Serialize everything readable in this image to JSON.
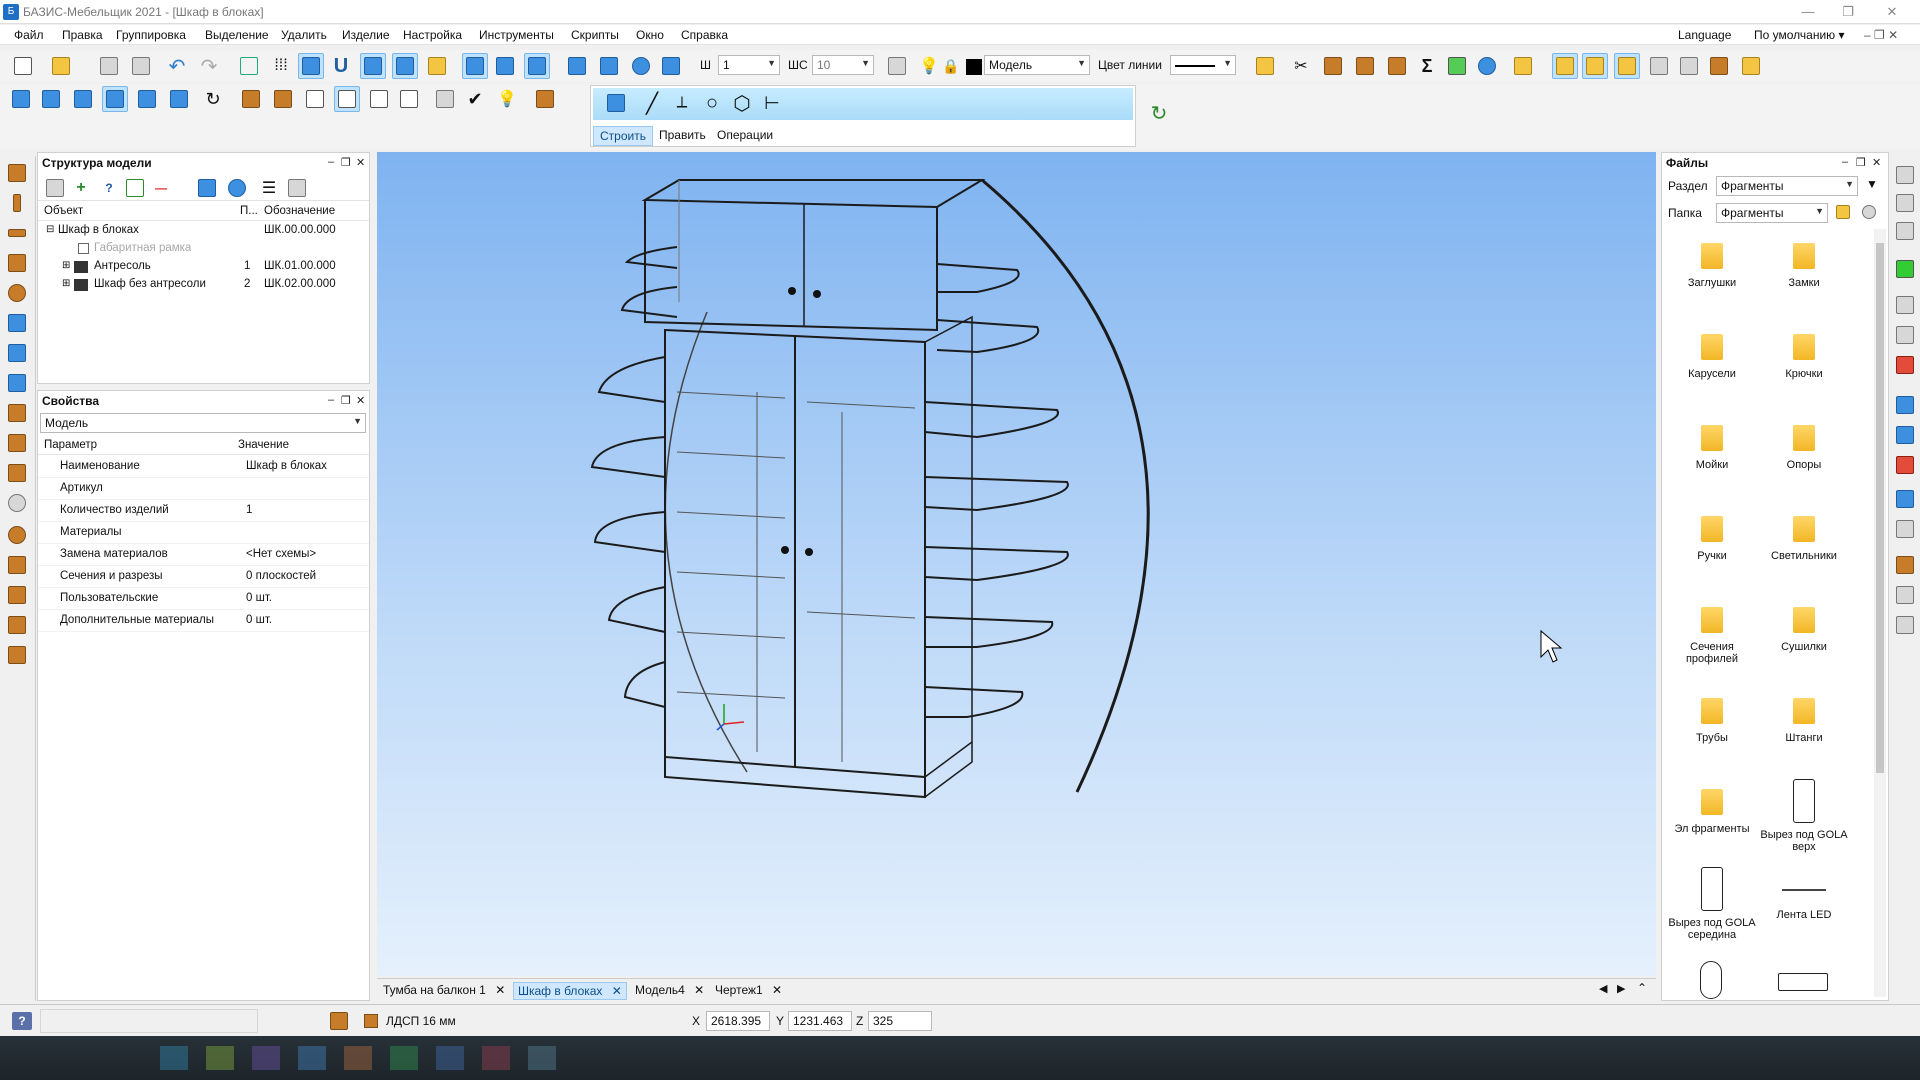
{
  "window": {
    "title": "БАЗИС-Мебельщик 2021 - [Шкаф в блоках]",
    "min": "—",
    "restore": "❐",
    "close": "✕"
  },
  "menu": {
    "items": [
      "Файл",
      "Правка",
      "Группировка",
      "Выделение",
      "Удалить",
      "Изделие",
      "Настройка",
      "Инструменты",
      "Скрипты",
      "Окно",
      "Справка"
    ],
    "language": "Language",
    "default_label": "По умолчанию ▾"
  },
  "toolbar": {
    "w_label": "Ш",
    "w_value": "1",
    "ws_label": "ШС",
    "ws_value": "10",
    "layer_value": "Модель",
    "line_color_label": "Цвет линии",
    "sub_tabs": [
      "Строить",
      "Править",
      "Операции"
    ]
  },
  "structure": {
    "title": "Структура модели",
    "col_object": "Объект",
    "col_p": "П...",
    "col_designation": "Обозначение",
    "rows": [
      {
        "name": "Шкаф в блоках",
        "qty": "",
        "code": "ШК.00.00.000"
      },
      {
        "name": "Габаритная рамка",
        "qty": "",
        "code": ""
      },
      {
        "name": "Антресоль",
        "qty": "1",
        "code": "ШК.01.00.000"
      },
      {
        "name": "Шкаф без антресоли",
        "qty": "2",
        "code": "ШК.02.00.000"
      }
    ]
  },
  "properties": {
    "title": "Свойства",
    "selector": "Модель",
    "col_param": "Параметр",
    "col_value": "Значение",
    "rows": [
      {
        "param": "Наименование",
        "value": "Шкаф в блоках"
      },
      {
        "param": "Артикул",
        "value": ""
      },
      {
        "param": "Количество изделий",
        "value": "1"
      },
      {
        "param": "Материалы",
        "value": ""
      },
      {
        "param": "Замена материалов",
        "value": "<Нет схемы>"
      },
      {
        "param": "Сечения и разрезы",
        "value": "0 плоскостей"
      },
      {
        "param": "Пользовательские",
        "value": "0 шт."
      },
      {
        "param": "Дополнительные материалы",
        "value": "0 шт."
      }
    ]
  },
  "files": {
    "title": "Файлы",
    "section_label": "Раздел",
    "section_value": "Фрагменты",
    "folder_label": "Папка",
    "folder_value": "Фрагменты",
    "items": [
      "Заглушки",
      "Замки",
      "Карусели",
      "Крючки",
      "Мойки",
      "Опоры",
      "Ручки",
      "Светильники",
      "Сечения профилей",
      "Сушилки",
      "Трубы",
      "Штанги",
      "Эл фрагменты",
      "Вырез под GOLA верх",
      "Вырез под GOLA середина",
      "Лента LED"
    ]
  },
  "doc_tabs": [
    "Тумба на балкон 1",
    "Шкаф в блоках",
    "Модель4",
    "Чертеж1"
  ],
  "status": {
    "material": "ЛДСП 16 мм",
    "x_label": "X",
    "x_value": "2618.395",
    "y_label": "Y",
    "y_value": "1231.463",
    "z_label": "Z",
    "z_value": "325"
  },
  "colors": {
    "accent": "#3d8fe0",
    "active_tab": "#cfe8ff",
    "viewport_top": "#7fb3f0",
    "viewport_bottom": "#e5f0fc"
  }
}
